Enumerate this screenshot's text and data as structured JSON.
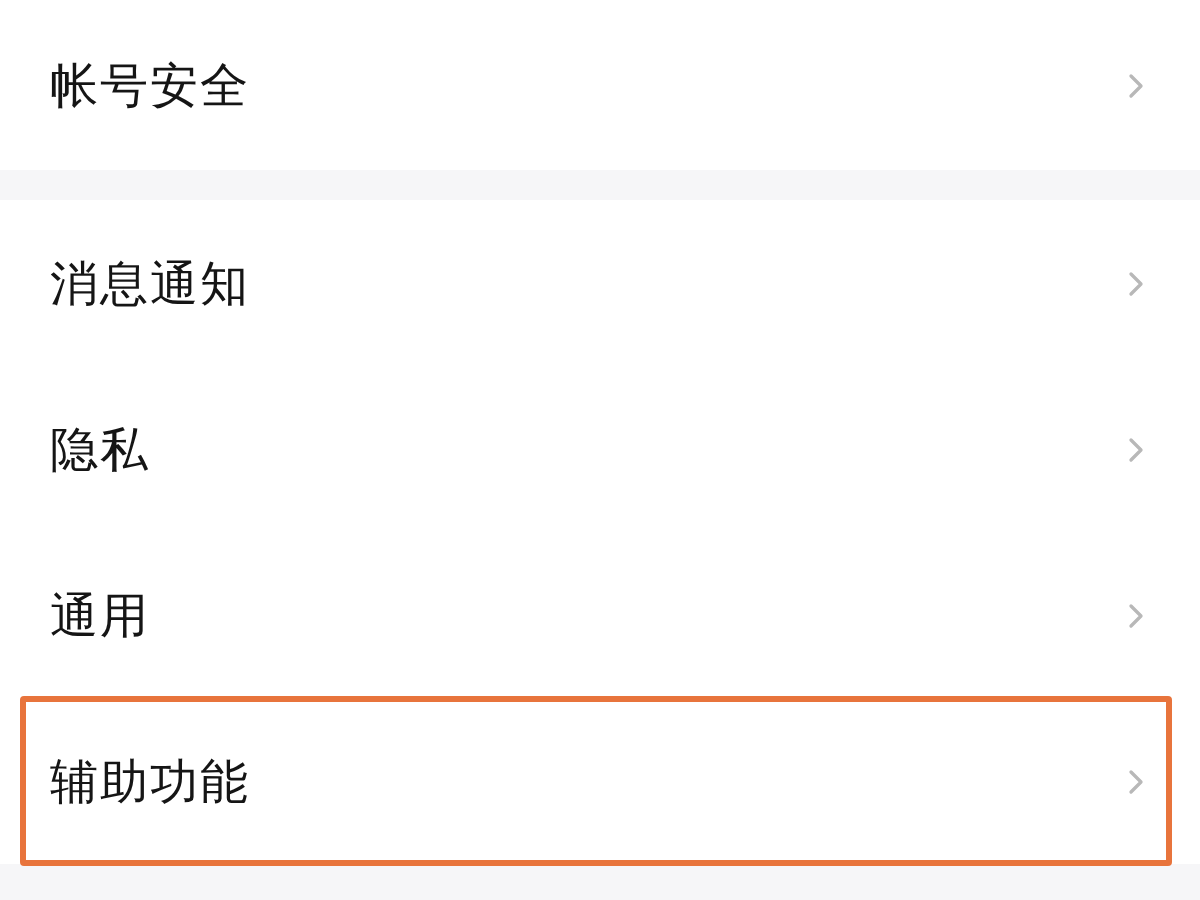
{
  "groups": [
    {
      "items": [
        {
          "label": "帐号安全",
          "highlighted": false
        }
      ]
    },
    {
      "items": [
        {
          "label": "消息通知",
          "highlighted": false
        },
        {
          "label": "隐私",
          "highlighted": false
        },
        {
          "label": "通用",
          "highlighted": false
        },
        {
          "label": "辅助功能",
          "highlighted": true
        }
      ]
    }
  ]
}
